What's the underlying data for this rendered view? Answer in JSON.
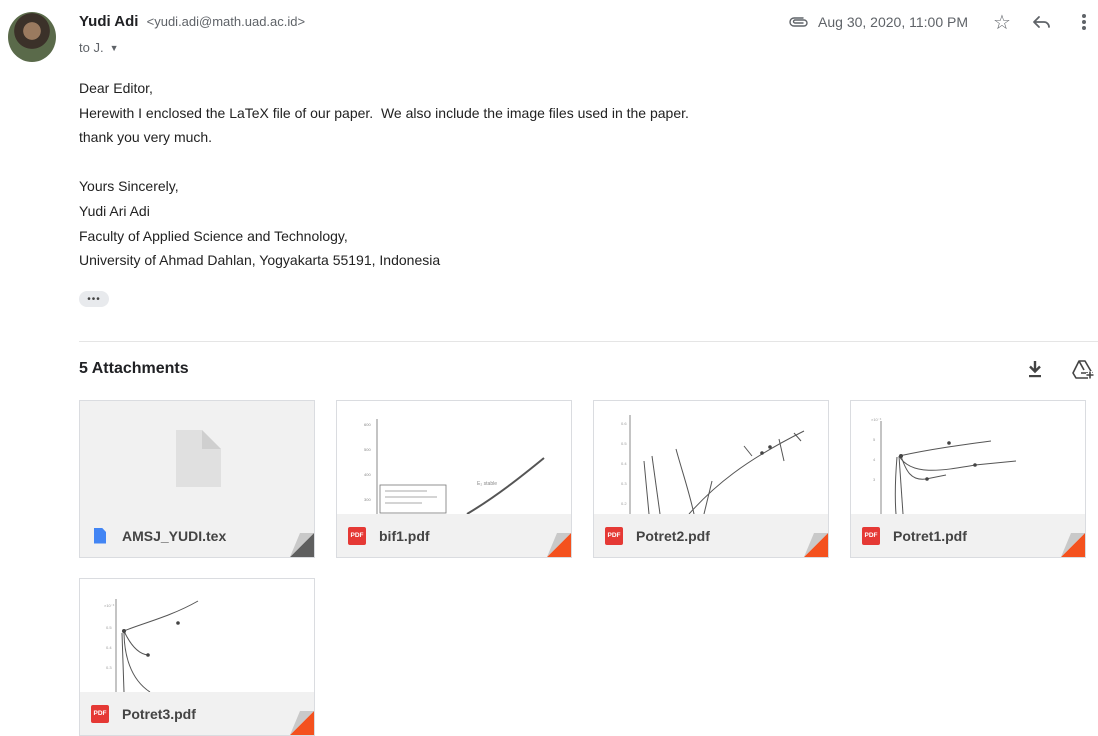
{
  "sender": {
    "name": "Yudi Adi",
    "email": "<yudi.adi@math.uad.ac.id>",
    "to": "to J."
  },
  "meta": {
    "date": "Aug 30, 2020, 11:00 PM"
  },
  "body_lines": [
    "Dear Editor,",
    "Herewith I enclosed the LaTeX file of our paper.  We also include the image files used in the paper.",
    "thank you very much.",
    "",
    "Yours Sincerely,",
    "Yudi Ari Adi",
    "Faculty of Applied Science and Technology,",
    "University of Ahmad Dahlan, Yogyakarta 55191, Indonesia"
  ],
  "dots": "•••",
  "attachments": {
    "title": "5 Attachments",
    "files": [
      {
        "name": "AMSJ_YUDI.tex",
        "type": "tex"
      },
      {
        "name": "bif1.pdf",
        "type": "pdf"
      },
      {
        "name": "Potret2.pdf",
        "type": "pdf"
      },
      {
        "name": "Potret1.pdf",
        "type": "pdf"
      },
      {
        "name": "Potret3.pdf",
        "type": "pdf"
      }
    ]
  },
  "pdf_badge": "PDF",
  "icons": {
    "attachment": "paperclip-icon",
    "star": "star-icon",
    "reply": "reply-icon",
    "more": "more-vert-icon",
    "download": "download-icon",
    "drive": "add-to-drive-icon"
  }
}
